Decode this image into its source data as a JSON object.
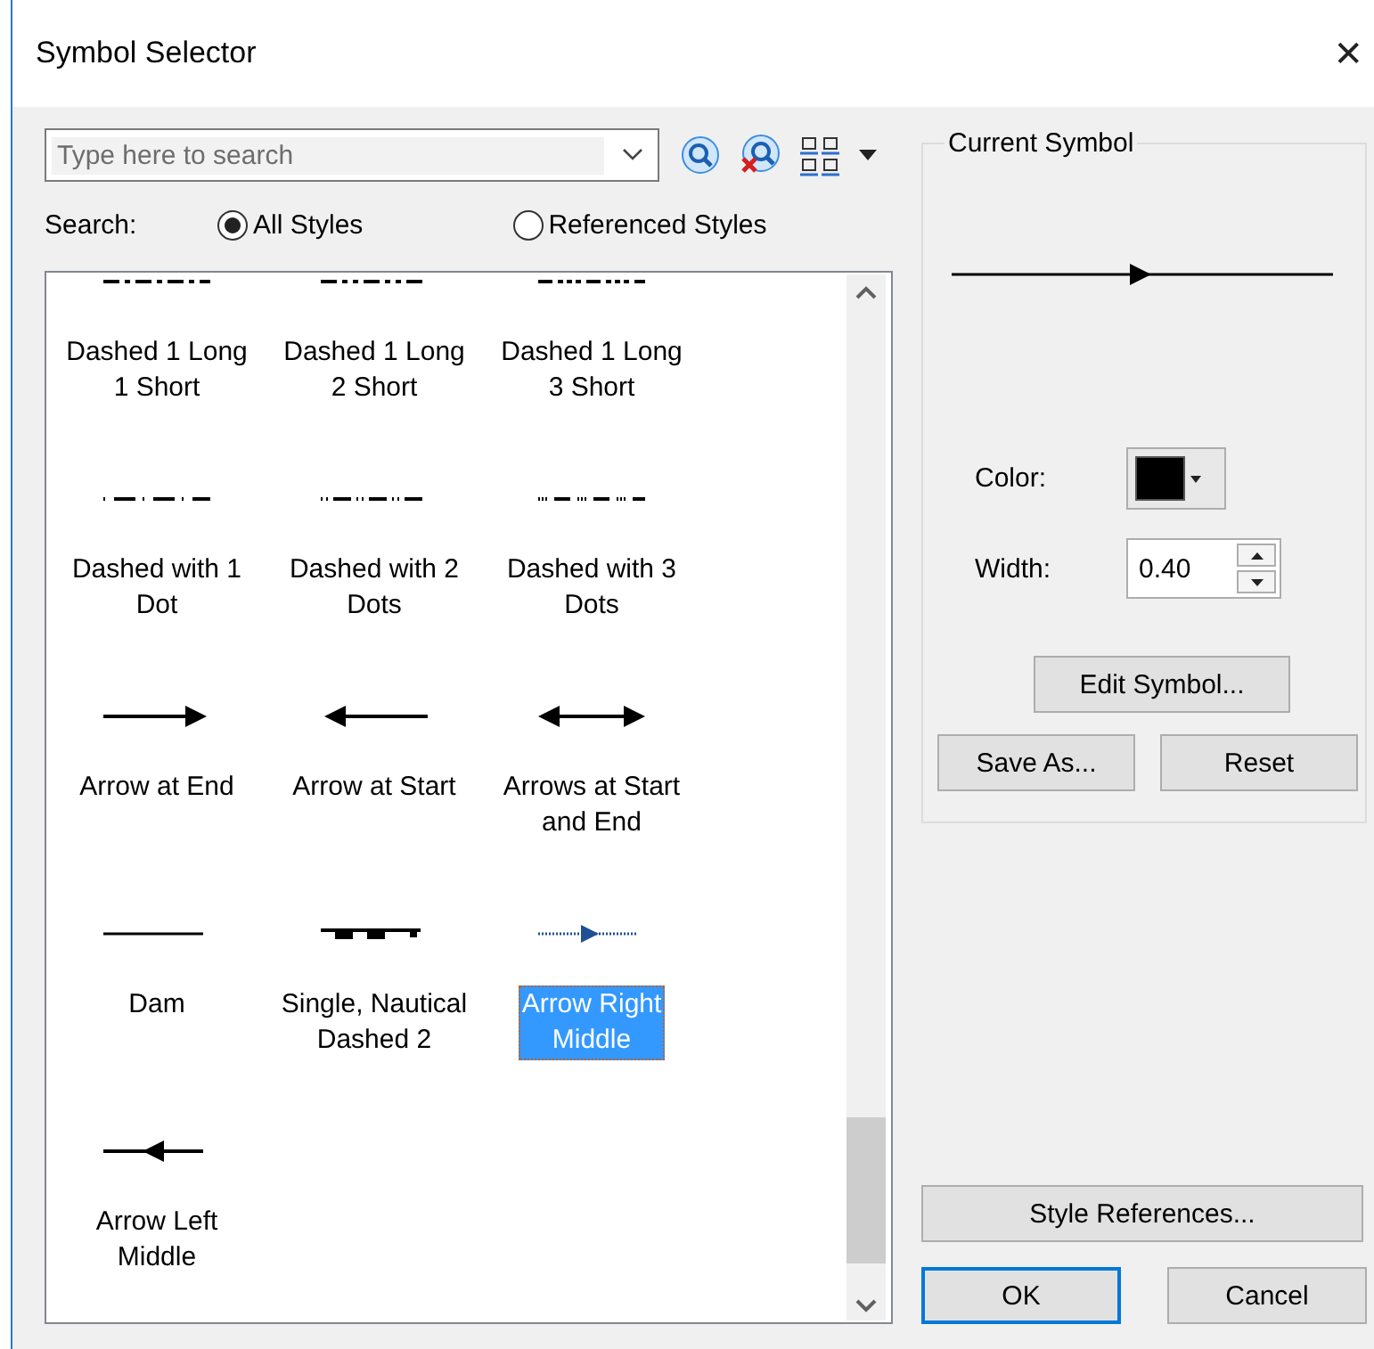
{
  "window": {
    "title": "Symbol Selector",
    "close": "✕"
  },
  "search": {
    "placeholder": "Type here to search"
  },
  "search_scope": {
    "label": "Search:",
    "options": [
      {
        "label": "All Styles",
        "selected": true
      },
      {
        "label": "Referenced Styles",
        "selected": false
      }
    ]
  },
  "symbols": [
    {
      "kind": "long1short",
      "label": "Dashed 1 Long\n1 Short",
      "selected": false
    },
    {
      "kind": "long2short",
      "label": "Dashed 1 Long\n2 Short",
      "selected": false
    },
    {
      "kind": "long3short",
      "label": "Dashed 1 Long\n3 Short",
      "selected": false
    },
    {
      "kind": "dot1",
      "label": "Dashed with 1\nDot",
      "selected": false
    },
    {
      "kind": "dot2",
      "label": "Dashed with 2\nDots",
      "selected": false
    },
    {
      "kind": "dot3",
      "label": "Dashed with 3\nDots",
      "selected": false
    },
    {
      "kind": "arrow_end",
      "label": "Arrow at End",
      "selected": false
    },
    {
      "kind": "arrow_start",
      "label": "Arrow at Start",
      "selected": false
    },
    {
      "kind": "arrow_both",
      "label": "Arrows at Start\nand End",
      "selected": false
    },
    {
      "kind": "plain",
      "label": "Dam",
      "selected": false
    },
    {
      "kind": "nautical",
      "label": "Single, Nautical\nDashed 2",
      "selected": false
    },
    {
      "kind": "arrow_mid_right",
      "label": "Arrow Right\nMiddle",
      "selected": true
    },
    {
      "kind": "arrow_mid_left",
      "label": "Arrow Left\nMiddle",
      "selected": false
    }
  ],
  "current_symbol": {
    "title": "Current Symbol",
    "color_label": "Color:",
    "color": "#000000",
    "width_label": "Width:",
    "width_value": "0.40"
  },
  "symbol_buttons": {
    "edit": "Edit Symbol...",
    "save_as": "Save As...",
    "reset": "Reset"
  },
  "style_references": "Style References...",
  "dialog_buttons": [
    {
      "label": "OK",
      "default": true
    },
    {
      "label": "Cancel",
      "default": false
    }
  ]
}
